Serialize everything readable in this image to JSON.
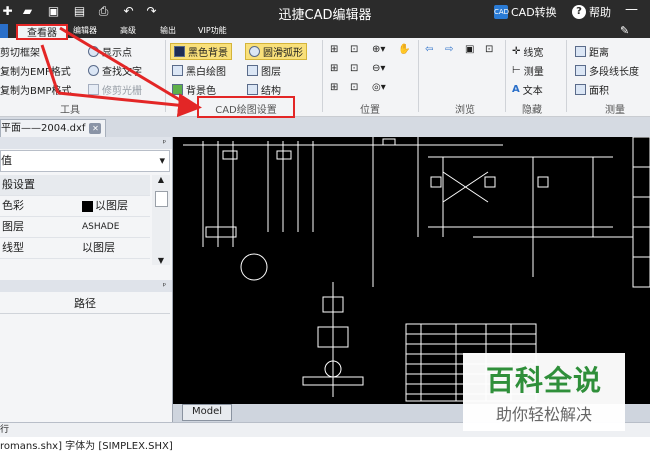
{
  "app": {
    "title": "迅捷CAD编辑器",
    "cad_convert": "CAD转换",
    "help": "帮助"
  },
  "tabs": {
    "viewer": "查看器",
    "items": [
      "编辑器",
      "高级",
      "输出",
      "VIP功能"
    ]
  },
  "ribbon": {
    "tools": {
      "label": "工具",
      "items": [
        "剪切框架",
        "复制为EMF格式",
        "复制为BMP格式",
        "显示点",
        "查找文字",
        "修剪光栅"
      ]
    },
    "cad_settings": {
      "label": "CAD绘图设置",
      "items": [
        "黑色背景",
        "黑白绘图",
        "背景色",
        "圆滑弧形",
        "图层",
        "结构"
      ]
    },
    "position": {
      "label": "位置"
    },
    "browse": {
      "label": "浏览"
    },
    "hide": {
      "label": "隐藏",
      "items": [
        "线宽",
        "测量",
        "文本"
      ]
    },
    "measure": {
      "label": "测量",
      "items": [
        "距离",
        "多段线长度",
        "面积"
      ]
    }
  },
  "document": {
    "tab_name": "平面——2004.dxf"
  },
  "properties": {
    "dropdown_value": "值",
    "section": "般设置",
    "rows": [
      {
        "key": "色彩",
        "value": "以图层"
      },
      {
        "key": "图层",
        "value": "ASHADE"
      },
      {
        "key": "线型",
        "value": "以图层"
      }
    ]
  },
  "layers_panel": {
    "column": "路径"
  },
  "model_tab": "Model",
  "command_label": "行",
  "status_text": "romans.shx] 字体为 [SIMPLEX.SHX]",
  "watermark": {
    "title": "百科全说",
    "subtitle": "助你轻松解决"
  },
  "colors": {
    "highlight": "#e32626",
    "accent_green": "#2f8f3a",
    "titlebar": "#2b2b2b"
  }
}
